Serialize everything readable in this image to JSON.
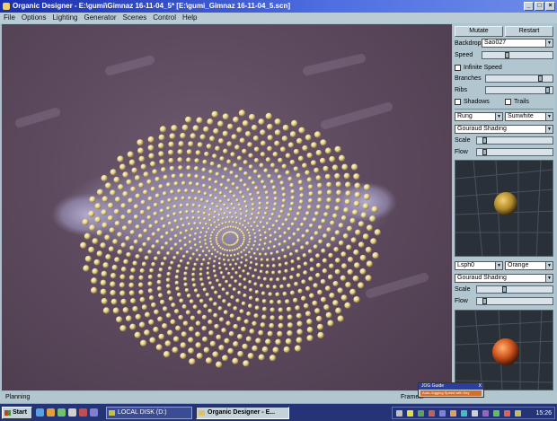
{
  "window": {
    "title": "Organic Designer - E:\\gumi\\Gimnaz 16-11-04_5* [E:\\gumi_Gimnaz 16-11-04_5.scn]",
    "controls": [
      "_",
      "□",
      "×"
    ]
  },
  "menu": [
    "File",
    "Options",
    "Lighting",
    "Generator",
    "Scenes",
    "Control",
    "Help"
  ],
  "panel": {
    "mutate_label": "Mutate",
    "restart_label": "Restart",
    "backdrop_label": "Backdrop",
    "backdrop_value": "Sao027",
    "speed_label": "Speed",
    "infinite_speed_label": "Infinite Speed",
    "branches_label": "Branches",
    "ribs_label": "Ribs",
    "shadows_label": "Shadows",
    "trails_label": "Trails",
    "material1": {
      "object": "Rung",
      "texture": "Sunwhite",
      "shading": "Gouraud Shading",
      "scale_label": "Scale",
      "flow_label": "Flow"
    },
    "material2": {
      "object": "Lsph0",
      "texture": "Orange",
      "shading": "Gouraud Shading",
      "scale_label": "Scale",
      "flow_label": "Flow"
    }
  },
  "status": {
    "left": "Planning",
    "frames_label": "Frames:"
  },
  "jog_guide": {
    "title": "JOG Guide",
    "close": "X",
    "body": "Auto-Jogging Speed with Key"
  },
  "taskbar": {
    "start_label": "Start",
    "tasks": [
      {
        "label": "LOCAL DISK (D:)",
        "active": false
      },
      {
        "label": "Organic Designer - E...",
        "active": true
      }
    ],
    "clock": "15:26"
  },
  "spiral": {
    "points": 1100,
    "arms": 34
  },
  "colors": {
    "titlebar": "#1b2fb0",
    "backdrop": "#5e4a5e",
    "sphere": "#e6d28c"
  }
}
